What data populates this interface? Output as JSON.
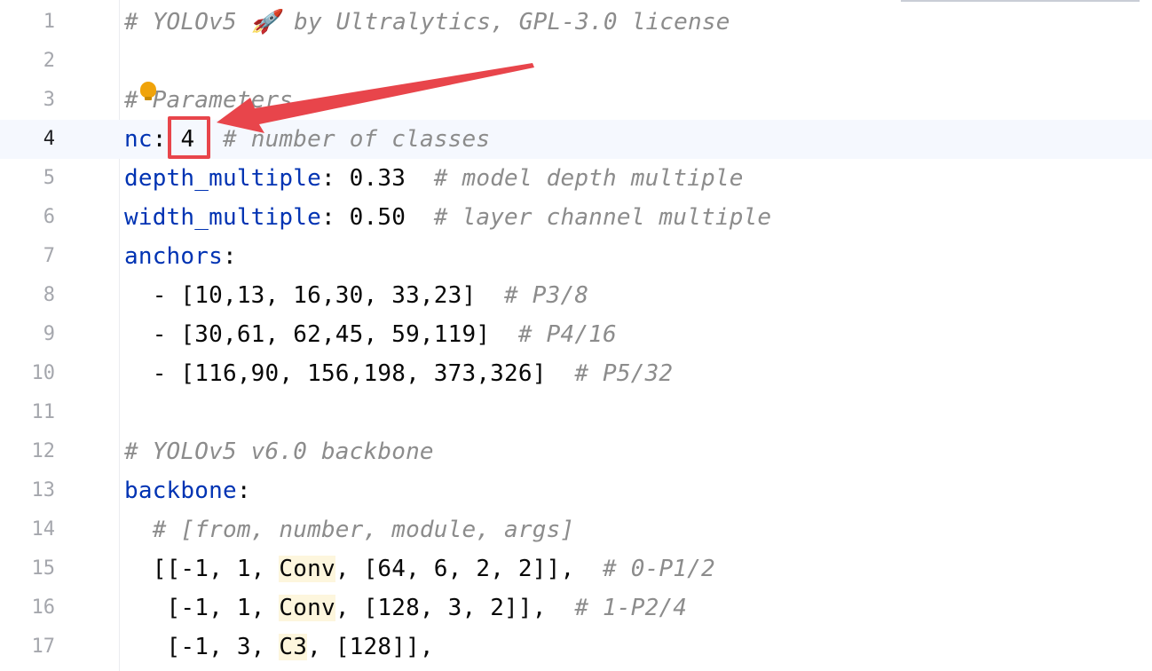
{
  "editor": {
    "current_line": 4,
    "lines": [
      {
        "num": "1",
        "parts": [
          {
            "t": "# YOLOv5 🚀 by Ultralytics, GPL-3.0 license",
            "c": "cm"
          }
        ]
      },
      {
        "num": "2",
        "parts": []
      },
      {
        "num": "3",
        "parts": [
          {
            "t": "# Parameters",
            "c": "cm"
          }
        ]
      },
      {
        "num": "4",
        "parts": [
          {
            "t": "nc",
            "c": "key"
          },
          {
            "t": ": ",
            "c": ""
          },
          {
            "t": "4",
            "c": ""
          },
          {
            "t": "  ",
            "c": ""
          },
          {
            "t": "# number of classes",
            "c": "cm"
          }
        ]
      },
      {
        "num": "5",
        "parts": [
          {
            "t": "depth_multiple",
            "c": "key"
          },
          {
            "t": ": 0.33  ",
            "c": ""
          },
          {
            "t": "# model depth multiple",
            "c": "cm"
          }
        ]
      },
      {
        "num": "6",
        "parts": [
          {
            "t": "width_multiple",
            "c": "key"
          },
          {
            "t": ": 0.50  ",
            "c": ""
          },
          {
            "t": "# layer channel multiple",
            "c": "cm"
          }
        ]
      },
      {
        "num": "7",
        "parts": [
          {
            "t": "anchors",
            "c": "key"
          },
          {
            "t": ":",
            "c": ""
          }
        ]
      },
      {
        "num": "8",
        "parts": [
          {
            "t": "  - [10,13, 16,30, 33,23]  ",
            "c": ""
          },
          {
            "t": "# P3/8",
            "c": "cm"
          }
        ]
      },
      {
        "num": "9",
        "parts": [
          {
            "t": "  - [30,61, 62,45, 59,119]  ",
            "c": ""
          },
          {
            "t": "# P4/16",
            "c": "cm"
          }
        ]
      },
      {
        "num": "10",
        "parts": [
          {
            "t": "  - [116,90, 156,198, 373,326]  ",
            "c": ""
          },
          {
            "t": "# P5/32",
            "c": "cm"
          }
        ]
      },
      {
        "num": "11",
        "parts": []
      },
      {
        "num": "12",
        "parts": [
          {
            "t": "# YOLOv5 v6.0 backbone",
            "c": "cm"
          }
        ]
      },
      {
        "num": "13",
        "parts": [
          {
            "t": "backbone",
            "c": "key"
          },
          {
            "t": ":",
            "c": ""
          }
        ]
      },
      {
        "num": "14",
        "parts": [
          {
            "t": "  ",
            "c": ""
          },
          {
            "t": "# [from, number, module, args]",
            "c": "cm"
          }
        ]
      },
      {
        "num": "15",
        "parts": [
          {
            "t": "  [[-1, 1, ",
            "c": ""
          },
          {
            "t": "Conv",
            "c": "mod"
          },
          {
            "t": ", [64, 6, 2, 2]],  ",
            "c": ""
          },
          {
            "t": "# 0-P1/2",
            "c": "cm"
          }
        ]
      },
      {
        "num": "16",
        "parts": [
          {
            "t": "   [-1, 1, ",
            "c": ""
          },
          {
            "t": "Conv",
            "c": "mod"
          },
          {
            "t": ", [128, 3, 2]],  ",
            "c": ""
          },
          {
            "t": "# 1-P2/4",
            "c": "cm"
          }
        ]
      },
      {
        "num": "17",
        "parts": [
          {
            "t": "   [-1, 3, ",
            "c": ""
          },
          {
            "t": "C3",
            "c": "mod"
          },
          {
            "t": ", [128]],",
            "c": ""
          }
        ]
      }
    ]
  },
  "annotation": {
    "arrow_color": "#e8454b",
    "box_color": "#e8454b"
  },
  "icons": {
    "intention_bulb": "lightbulb-icon"
  }
}
